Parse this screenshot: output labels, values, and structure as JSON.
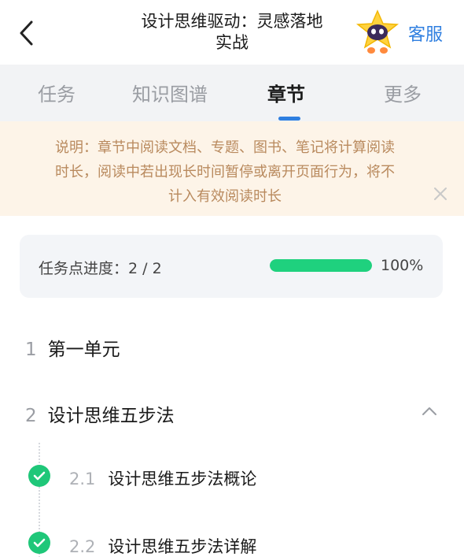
{
  "header": {
    "title_line1": "设计思维驱动：灵感落地",
    "title_line2": "实战",
    "service_label": "客服",
    "back_icon": "chevron-left-icon",
    "mascot_icon": "star-mascot-icon"
  },
  "tabs": [
    {
      "label": "任务"
    },
    {
      "label": "知识图谱"
    },
    {
      "label": "章节"
    },
    {
      "label": "更多"
    }
  ],
  "active_tab": "章节",
  "notice": {
    "line1": "说明：章节中阅读文档、专题、图书、笔记将计算阅读",
    "line2": "时长，阅读中若出现长时间暂停或离开页面行为，将不",
    "line3": "计入有效阅读时长"
  },
  "progress": {
    "label": "任务点进度：2 / 2",
    "percent_text": "100%",
    "fraction": 1.0
  },
  "chapters": [
    {
      "num": "1",
      "title": "第一单元"
    },
    {
      "num": "2",
      "title": "设计思维五步法"
    }
  ],
  "subsections": [
    {
      "num": "2.1",
      "title": "设计思维五步法概论",
      "completed": true
    },
    {
      "num": "2.2",
      "title": "设计思维五步法详解",
      "completed": true
    }
  ],
  "colors": {
    "accent": "#2f7fe0",
    "success": "#1fd17e",
    "notice_bg": "#fdf4e8",
    "notice_text": "#b98a5e"
  }
}
